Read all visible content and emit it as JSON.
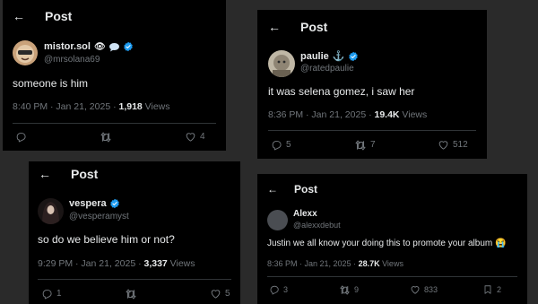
{
  "posts": [
    {
      "header_title": "Post",
      "display_name": "mistor.sol",
      "name_suffix": "👁",
      "handle": "@mrsolana69",
      "text": "someone is him",
      "time": "8:40 PM · Jan 21, 2025 · ",
      "views_count": "1,918",
      "views_label": " Views",
      "actions": {
        "replies": "",
        "reposts": "",
        "likes": "4",
        "bookmarks": ""
      }
    },
    {
      "header_title": "Post",
      "display_name": "paulie",
      "name_suffix": "⚓",
      "handle": "@ratedpaulie",
      "text": "it was selena gomez, i saw her",
      "time": "8:36 PM · Jan 21, 2025 · ",
      "views_count": "19.4K",
      "views_label": " Views",
      "actions": {
        "replies": "5",
        "reposts": "7",
        "likes": "512",
        "bookmarks": ""
      }
    },
    {
      "header_title": "Post",
      "display_name": "vespera",
      "name_suffix": "",
      "handle": "@vesperamyst",
      "text": "so do we believe him or not?",
      "time": "9:29 PM · Jan 21, 2025 · ",
      "views_count": "3,337",
      "views_label": " Views",
      "actions": {
        "replies": "1",
        "reposts": "",
        "likes": "5",
        "bookmarks": ""
      }
    },
    {
      "header_title": "Post",
      "display_name": "Alexx",
      "name_suffix": "",
      "handle": "@alexxdebut",
      "text": "Justin we all know your doing this to promote your album 😭",
      "time": "8:36 PM · Jan 21, 2025 · ",
      "views_count": "28.7K",
      "views_label": " Views",
      "actions": {
        "replies": "3",
        "reposts": "9",
        "likes": "833",
        "bookmarks": "2"
      }
    }
  ],
  "colors": {
    "background": "#000000",
    "text": "#e7e9ea",
    "muted": "#71767b",
    "verified": "#1d9bf0",
    "divider": "#2f3336"
  },
  "icons": {
    "back": "arrow-left-icon",
    "verified": "verified-badge-icon",
    "reply": "reply-icon",
    "repost": "repost-icon",
    "like": "heart-icon",
    "bookmark": "bookmark-icon"
  }
}
